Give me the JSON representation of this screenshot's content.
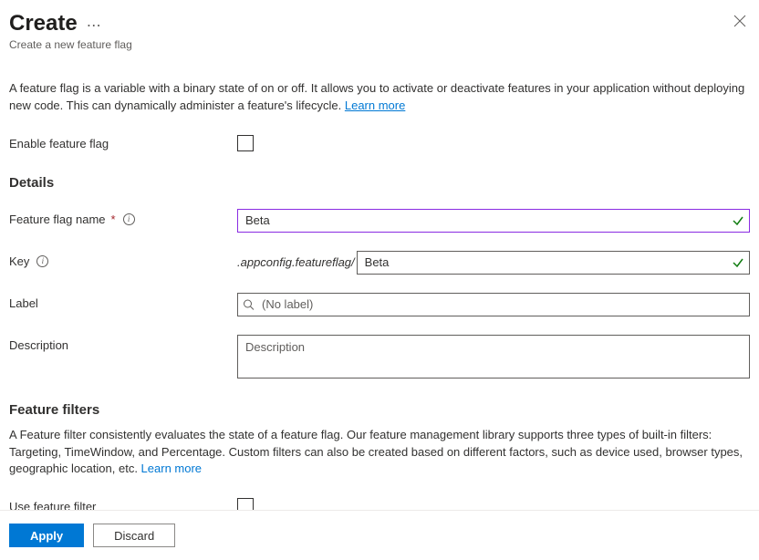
{
  "header": {
    "title": "Create",
    "subtitle": "Create a new feature flag"
  },
  "intro": {
    "text": "A feature flag is a variable with a binary state of on or off. It allows you to activate or deactivate features in your application without deploying new code. This can dynamically administer a feature's lifecycle. ",
    "learn_more": "Learn more"
  },
  "enable": {
    "label": "Enable feature flag"
  },
  "details": {
    "heading": "Details",
    "name_label": "Feature flag name",
    "name_value": "Beta",
    "key_label": "Key",
    "key_prefix": ".appconfig.featureflag/",
    "key_value": "Beta",
    "label_label": "Label",
    "label_placeholder": "(No label)",
    "description_label": "Description",
    "description_placeholder": "Description"
  },
  "filters": {
    "heading": "Feature filters",
    "text": "A Feature filter consistently evaluates the state of a feature flag. Our feature management library supports three types of built-in filters: Targeting, TimeWindow, and Percentage. Custom filters can also be created based on different factors, such as device used, browser types, geographic location, etc. ",
    "learn_more": "Learn more",
    "use_label": "Use feature filter"
  },
  "footer": {
    "apply": "Apply",
    "discard": "Discard"
  }
}
